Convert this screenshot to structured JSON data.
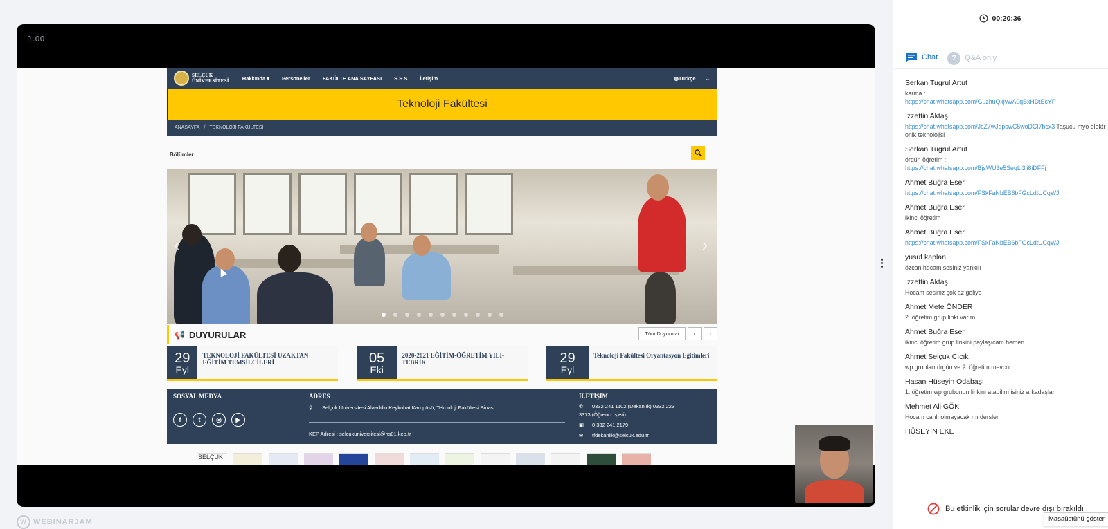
{
  "player": {
    "speed": "1.00",
    "timer": "00:20:36"
  },
  "site": {
    "logo_line1": "SELÇUK",
    "logo_line2": "ÜNİVERSİTESİ",
    "nav": [
      "Hakkında ▾",
      "Personeller",
      "FAKÜLTE ANA SAYFASI",
      "S.S.S",
      "İletişim"
    ],
    "lang": "Türkçe",
    "banner_title": "Teknoloji Fakültesi",
    "breadcrumb": [
      "ANASAYFA",
      "/",
      "TEKNOLOJİ FAKÜLTESİ"
    ],
    "bolumler": "Bölümler",
    "duyurular_title": "DUYURULAR",
    "tum_duyurular": "Tüm Duyurular",
    "prev": "‹",
    "next": "›",
    "news": [
      {
        "day": "29",
        "month": "Eyl",
        "title": "TEKNOLOJİ FAKÜLTESİ UZAKTAN EĞİTİM TEMSİLCİLERİ"
      },
      {
        "day": "05",
        "month": "Eki",
        "title": "2020-2021 EĞİTİM-ÖĞRETİM YILI-TEBRİK"
      },
      {
        "day": "29",
        "month": "Eyl",
        "title": "Teknoloji Fakültesi Oryantasyon Eğitimleri"
      }
    ],
    "footer": {
      "social_heading": "SOSYAL MEDYA",
      "address_heading": "ADRES",
      "address": "Selçuk Üniversitesi Alaaddin Keykubat Kampüsü, Teknoloji Fakültesi Binası",
      "kep": "KEP Adresi : selcukuniversitesi@hs01.kep.tr",
      "contact_heading": "İLETİŞİM",
      "phone1": "0332 241 1102 (Dekanlık) 0332 223",
      "phone1b": "3373 (Öğrenci İşleri)",
      "fax": "0 332 241 2179",
      "email": "tfdekanlik@selcuk.edu.tr",
      "social_letters": [
        "f",
        "t",
        "◎",
        "▶"
      ]
    },
    "logo_strip_first": "SELÇUK"
  },
  "panel": {
    "tab_chat": "Chat",
    "tab_qa": "Q&A only",
    "messages": [
      {
        "name": "Serkan Tugrul Artut",
        "text": "karma :",
        "link": "https://chat.whatsapp.com/GuzhuQxjvwA0qBxHDtEcYP",
        "after": ""
      },
      {
        "name": "İzzettin Aktaş",
        "text": "",
        "link": "https://chat.whatsapp.com/JcZ7wJqpswC5woDCI7bcx3",
        "after": " Taşucu myo elektronik teknolojisi"
      },
      {
        "name": "Serkan Tugrul Artut",
        "text": "örgün öğretim :",
        "link": "https://chat.whatsapp.com/BjsWU3e5SeqLi3ji8iDFFj",
        "after": ""
      },
      {
        "name": "Ahmet Buğra Eser",
        "text": "",
        "link": "https://chat.whatsapp.com/FSkFaNbEB6bFGcLdtUCqWJ",
        "after": ""
      },
      {
        "name": "Ahmet Buğra Eser",
        "text": "ikinci öğretim",
        "link": "",
        "after": ""
      },
      {
        "name": "Ahmet Buğra Eser",
        "text": "",
        "link": "https://chat.whatsapp.com/FSkFaNbEB6bFGcLdtUCqWJ",
        "after": ""
      },
      {
        "name": "yusuf kaplan",
        "text": "özcan hocam sesiniz yankılı",
        "link": "",
        "after": ""
      },
      {
        "name": "İzzettin Aktaş",
        "text": "Hocam sesiniz çok az geliyo",
        "link": "",
        "after": ""
      },
      {
        "name": "Ahmet Mete ÖNDER",
        "text": "2. öğretim grup linki var mı",
        "link": "",
        "after": ""
      },
      {
        "name": "Ahmet Buğra Eser",
        "text": "ikinci öğretim grup linkini paylaşıcam hemen",
        "link": "",
        "after": ""
      },
      {
        "name": "Ahmet Selçuk Cıcık",
        "text": "wp grupları örgün ve 2. öğretim mevcut",
        "link": "",
        "after": ""
      },
      {
        "name": "Hasan Hüseyin Odabaşı",
        "text": "1. öğretim wp grubunun linkini atabilirmisiniz arkadaşlar",
        "link": "",
        "after": ""
      },
      {
        "name": "Mehmet Ali GÖK",
        "text": "Hocam canlı olmayacak mı dersler",
        "link": "",
        "after": ""
      },
      {
        "name": "HÜSEYİN EKE",
        "text": "",
        "link": "",
        "after": ""
      }
    ],
    "qa_note": "Bu etkinlik için sorular devre dışı bırakıldı",
    "desktop_tooltip": "Masaüstünü göster"
  },
  "brand": "WEBINARJAM",
  "colors": {
    "navy": "#2e4158",
    "yellow": "#ffc800",
    "accent": "#1a73c4",
    "link": "#3a8fd0"
  }
}
